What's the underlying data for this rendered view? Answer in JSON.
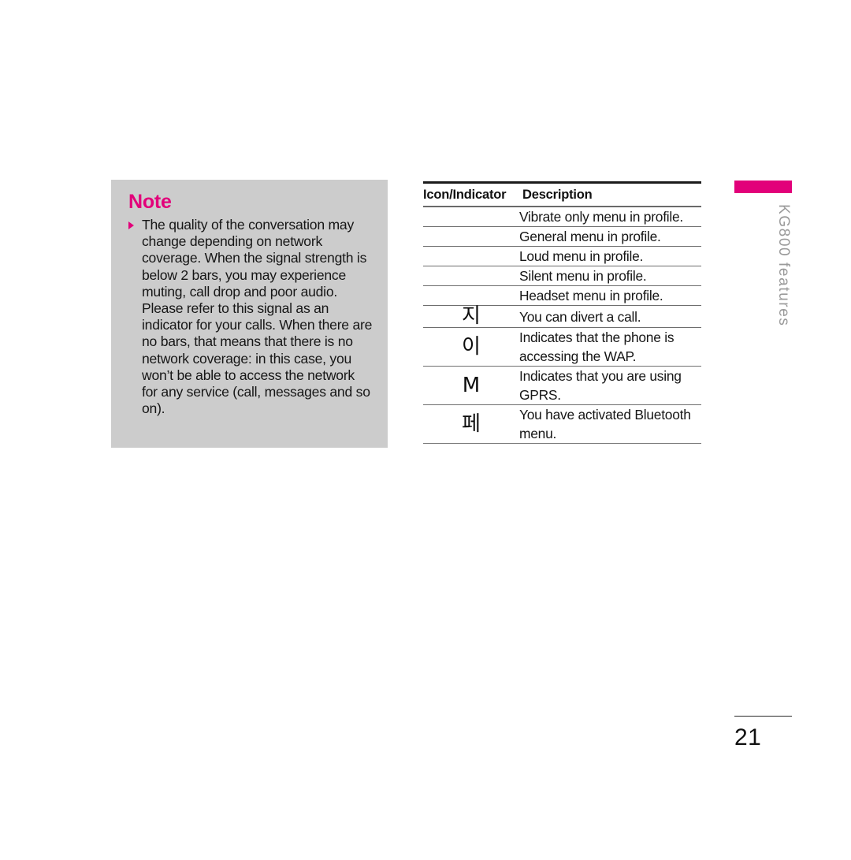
{
  "note": {
    "title": "Note",
    "bullet_icon": "triangle-right-icon",
    "body": "The quality of the conversation may change depending on network coverage. When the signal strength is below 2 bars, you may experience muting, call drop and poor audio. Please refer to this signal as an indicator for your calls. When there are no bars, that means that there is no network coverage: in this case, you won’t be able to access the network for any service (call, messages and so on).",
    "background_color": "#CCCCCC",
    "accent_color": "#E2007A"
  },
  "table": {
    "headers": {
      "icon": "Icon/Indicator",
      "description": "Description"
    },
    "rows": [
      {
        "icon": "",
        "icon_name": "vibrate-only-indicator-icon",
        "description": "Vibrate only menu in profile."
      },
      {
        "icon": "",
        "icon_name": "general-profile-indicator-icon",
        "description": "General menu in profile."
      },
      {
        "icon": "",
        "icon_name": "loud-profile-indicator-icon",
        "description": "Loud menu in profile."
      },
      {
        "icon": "",
        "icon_name": "silent-profile-indicator-icon",
        "description": "Silent menu in profile."
      },
      {
        "icon": "",
        "icon_name": "headset-profile-indicator-icon",
        "description": "Headset menu in profile."
      },
      {
        "icon": "지",
        "icon_name": "call-divert-indicator-icon",
        "description": "You can divert a call."
      },
      {
        "icon": "이",
        "icon_name": "wap-access-indicator-icon",
        "description": "Indicates that the phone is accessing the WAP."
      },
      {
        "icon": "M",
        "icon_name": "gprs-indicator-icon",
        "description": "Indicates that you are using GPRS."
      },
      {
        "icon": "페",
        "icon_name": "bluetooth-indicator-icon",
        "description": "You have activated Bluetooth menu."
      }
    ]
  },
  "side_tab": {
    "label": "KG800 features",
    "bar_color": "#E2007A",
    "label_color": "#9A9A9A"
  },
  "footer": {
    "page_number": "21"
  }
}
